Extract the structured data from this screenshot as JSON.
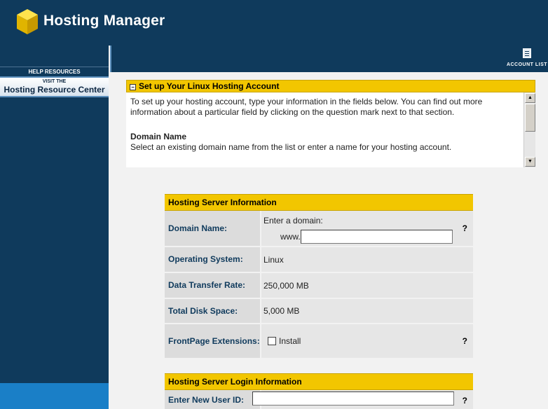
{
  "header": {
    "title": "Hosting Manager",
    "logo_icon": "yellow-cube-icon"
  },
  "sidebar": {
    "help_resources": "HELP RESOURCES",
    "banner_line1": "VISIT THE",
    "banner_line2": "Hosting Resource Center"
  },
  "toolbar": {
    "account_list_label": "ACCOUNT LIST",
    "account_list_icon": "list-icon"
  },
  "info_panel": {
    "title": "Set up Your Linux Hosting Account",
    "collapse_symbol": "−",
    "intro": "To set up your hosting account, type your information in the fields below. You can find out more information about a particular field by clicking on the question mark next to that section.",
    "domain_heading": "Domain Name",
    "domain_text": "Select an existing domain name from the list or enter a name for your hosting account."
  },
  "server_info": {
    "title": "Hosting Server Information",
    "domain_label": "Domain Name:",
    "domain_prompt": "Enter a domain:",
    "www_prefix": "www.",
    "domain_value": "",
    "os_label": "Operating System:",
    "os_value": "Linux",
    "transfer_label": "Data Transfer Rate:",
    "transfer_value": "250,000 MB",
    "disk_label": "Total Disk Space:",
    "disk_value": "5,000 MB",
    "frontpage_label": "FrontPage Extensions:",
    "frontpage_option": "Install",
    "frontpage_checked": false,
    "help_symbol": "?"
  },
  "login_info": {
    "title": "Hosting Server Login Information",
    "userid_label": "Enter New User ID:",
    "userid_value": "",
    "help_symbol": "?"
  },
  "colors": {
    "navy": "#0f3a5c",
    "accent_yellow": "#f2c600",
    "sidebar_bottom_blue": "#1a7fc7",
    "label_blue": "#0f3a5c"
  }
}
